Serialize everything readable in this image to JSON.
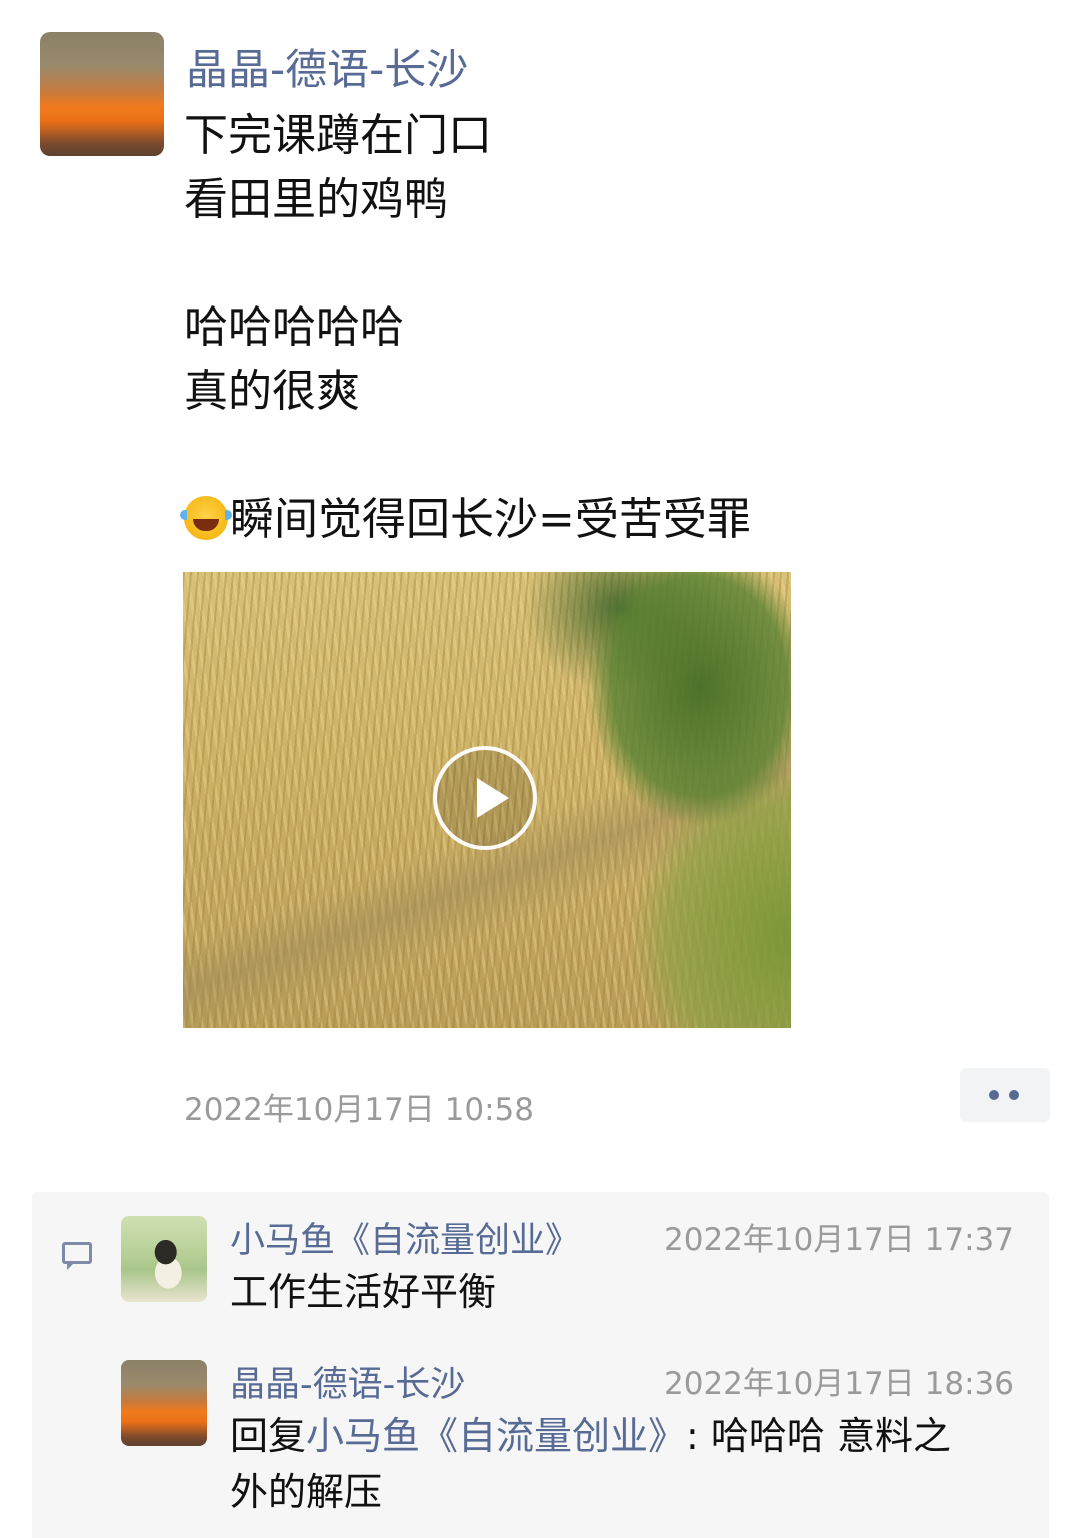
{
  "post": {
    "author": "晶晶-德语-长沙",
    "lines": [
      "下完课蹲在门口",
      "看田里的鸡鸭",
      "",
      "哈哈哈哈哈",
      "真的很爽",
      ""
    ],
    "emoji_icon": "tears-of-joy-emoji",
    "last_line": "瞬间觉得回长沙=受苦受罪",
    "video_icon": "play-icon",
    "timestamp": "2022年10月17日 10:58",
    "more_icon": "more-dots-icon"
  },
  "comments": [
    {
      "name": "小马鱼《自流量创业》",
      "time": "2022年10月17日 17:37",
      "text": "工作生活好平衡"
    },
    {
      "name": "晶晶-德语-长沙",
      "time": "2022年10月17日 18:36",
      "reply_prefix": "回复",
      "reply_to": "小马鱼《自流量创业》",
      "text_line1": ": 哈哈哈 意料之",
      "text_line2": "外的解压"
    }
  ],
  "colors": {
    "link": "#576b95",
    "meta": "#9a9a9a",
    "comment_bg": "#f6f6f6"
  }
}
